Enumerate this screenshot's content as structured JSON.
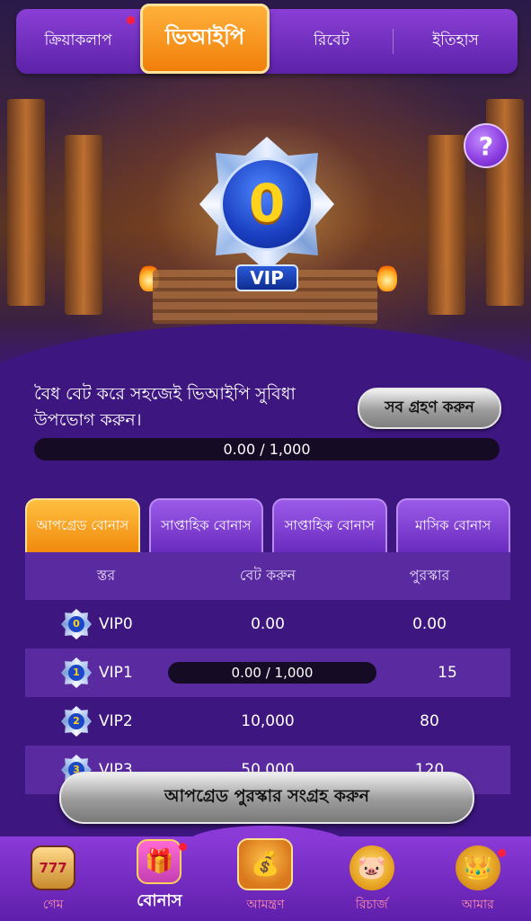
{
  "top_tabs": [
    {
      "label": "ক্রিয়াকলাপ",
      "has_dot": true
    },
    {
      "label": "ভিআইপি",
      "active": true
    },
    {
      "label": "রিবেট"
    },
    {
      "label": "ইতিহাস"
    }
  ],
  "help_label": "?",
  "vip_badge": {
    "level": "0",
    "tag": "VIP"
  },
  "info": {
    "text": "বৈধ বেট করে সহজেই ভিআইপি সুবিধা উপভোগ করুন।",
    "claim_all_label": "সব গ্রহণ করুন",
    "progress_text": "0.00 / 1,000",
    "progress_fraction": 0
  },
  "bonus_tabs": [
    {
      "label": "আপগ্রেড বোনাস",
      "active": true
    },
    {
      "label": "সাপ্তাহিক বোনাস"
    },
    {
      "label": "সাপ্তাহিক বোনাস"
    },
    {
      "label": "মাসিক বোনাস"
    }
  ],
  "table": {
    "headers": [
      "স্তর",
      "বেট করুন",
      "পুরস্কার"
    ],
    "rows": [
      {
        "badge": "0",
        "tier": "VIP0",
        "bet": "0.00",
        "reward": "0.00"
      },
      {
        "badge": "1",
        "tier": "VIP1",
        "bet": "0.00 / 1,000",
        "reward": "15",
        "progress_fraction": 0
      },
      {
        "badge": "2",
        "tier": "VIP2",
        "bet": "10,000",
        "reward": "80"
      },
      {
        "badge": "3",
        "tier": "VIP3",
        "bet": "50,000",
        "reward": "120"
      }
    ]
  },
  "collect_button_label": "আপগ্রেড পুরস্কার সংগ্রহ করুন",
  "bottom_nav": [
    {
      "label": "গেম",
      "icon": "slot-machine-icon",
      "glyph": "777"
    },
    {
      "label": "বোনাস",
      "icon": "gift-box-icon",
      "glyph": "🎁",
      "active": true,
      "has_dot": true
    },
    {
      "label": "আমন্ত্রণ",
      "icon": "treasure-chest-icon",
      "glyph": "💰"
    },
    {
      "label": "রিচার্জ",
      "icon": "piggy-bank-icon",
      "glyph": "🐷"
    },
    {
      "label": "আমার",
      "icon": "profile-icon",
      "glyph": "👑",
      "has_dot": true
    }
  ],
  "colors": {
    "background": "#3d1680",
    "accent_orange": "#f08a0e",
    "tab_purple": "#8a3fd6",
    "progress_track": "#150b25",
    "notification_dot": "#ff1e3c"
  }
}
